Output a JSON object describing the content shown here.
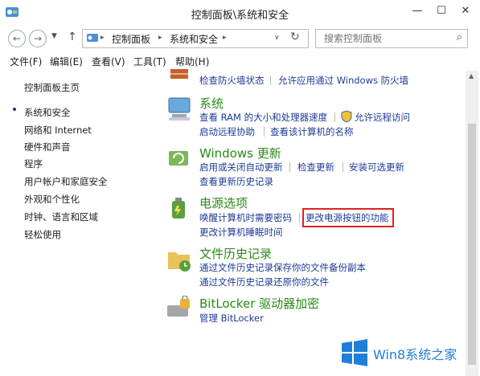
{
  "window": {
    "title": "控制面板\\系统和安全"
  },
  "address": {
    "crumbs": [
      "控制面板",
      "系统和安全"
    ],
    "search_placeholder": "搜索控制面板"
  },
  "menu": [
    "文件(F)",
    "编辑(E)",
    "查看(V)",
    "工具(T)",
    "帮助(H)"
  ],
  "sidebar": {
    "home": "控制面板主页",
    "items": [
      "系统和安全",
      "网络和 Internet",
      "硬件和声音",
      "程序",
      "用户帐户和家庭安全",
      "外观和个性化",
      "时钟、语言和区域",
      "轻松使用"
    ]
  },
  "sections": {
    "firewall": {
      "links": [
        "检查防火墙状态",
        "允许应用通过 Windows 防火墙"
      ]
    },
    "system": {
      "title": "系统",
      "links": [
        "查看 RAM 的大小和处理器速度",
        "允许远程访问",
        "启动远程协助",
        "查看该计算机的名称"
      ]
    },
    "update": {
      "title": "Windows 更新",
      "links": [
        "启用或关闭自动更新",
        "检查更新",
        "安装可选更新",
        "查看更新历史记录"
      ]
    },
    "power": {
      "title": "电源选项",
      "links": [
        "唤醒计算机时需要密码",
        "更改电源按钮的功能",
        "更改计算机睡眠时间"
      ]
    },
    "history": {
      "title": "文件历史记录",
      "links": [
        "通过文件历史记录保存你的文件备份副本",
        "通过文件历史记录还原你的文件"
      ]
    },
    "bitlocker": {
      "title": "BitLocker 驱动器加密",
      "links": [
        "管理 BitLocker"
      ]
    }
  },
  "watermark": {
    "text": "Win8系统之家"
  },
  "colors": {
    "link": "#1c3b96",
    "category": "#2a8a18",
    "highlight": "#e02020",
    "logo_blue": "#1f7fd8"
  }
}
